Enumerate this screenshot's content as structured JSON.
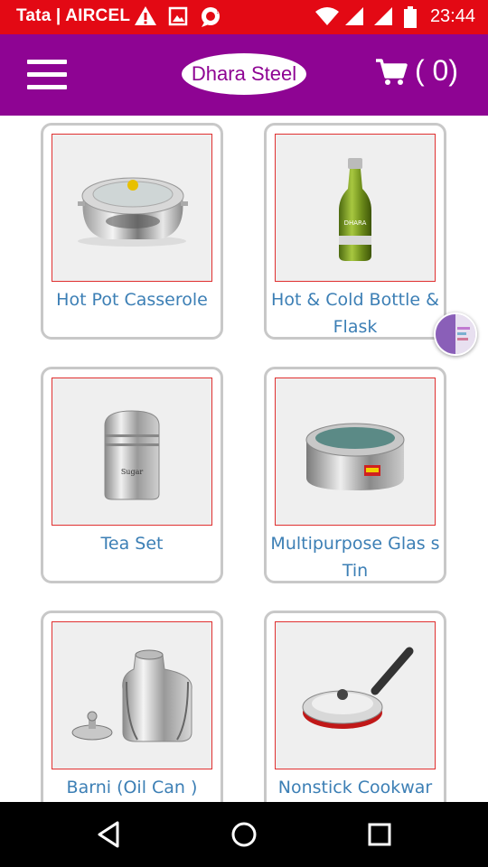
{
  "status_bar": {
    "carrier": "Tata | AIRCEL",
    "time": "23:44"
  },
  "header": {
    "logo_text": "Dhara Steel",
    "cart_count": "( 0)"
  },
  "products": [
    {
      "name": "Hot Pot Casserole",
      "image": "hot-pot-casserole-image"
    },
    {
      "name": "Hot & Cold Bottle & Flask",
      "image": "bottle-flask-image"
    },
    {
      "name": "Tea Set",
      "image": "tea-set-canister-image"
    },
    {
      "name": "Multipurpose Glass Tin",
      "name_display": "Multipurpose Glas s Tin",
      "image": "glass-tin-image"
    },
    {
      "name": "Barni (Oil Can )",
      "image": "oil-can-image"
    },
    {
      "name": "Nonstick Cookwar",
      "image": "nonstick-pan-image"
    }
  ],
  "colors": {
    "status_bar": "#e30914",
    "app_bar": "#8e0493",
    "product_label": "#3c7fb5",
    "card_border": "#c8c8c8",
    "thumb_border": "#e03030"
  }
}
